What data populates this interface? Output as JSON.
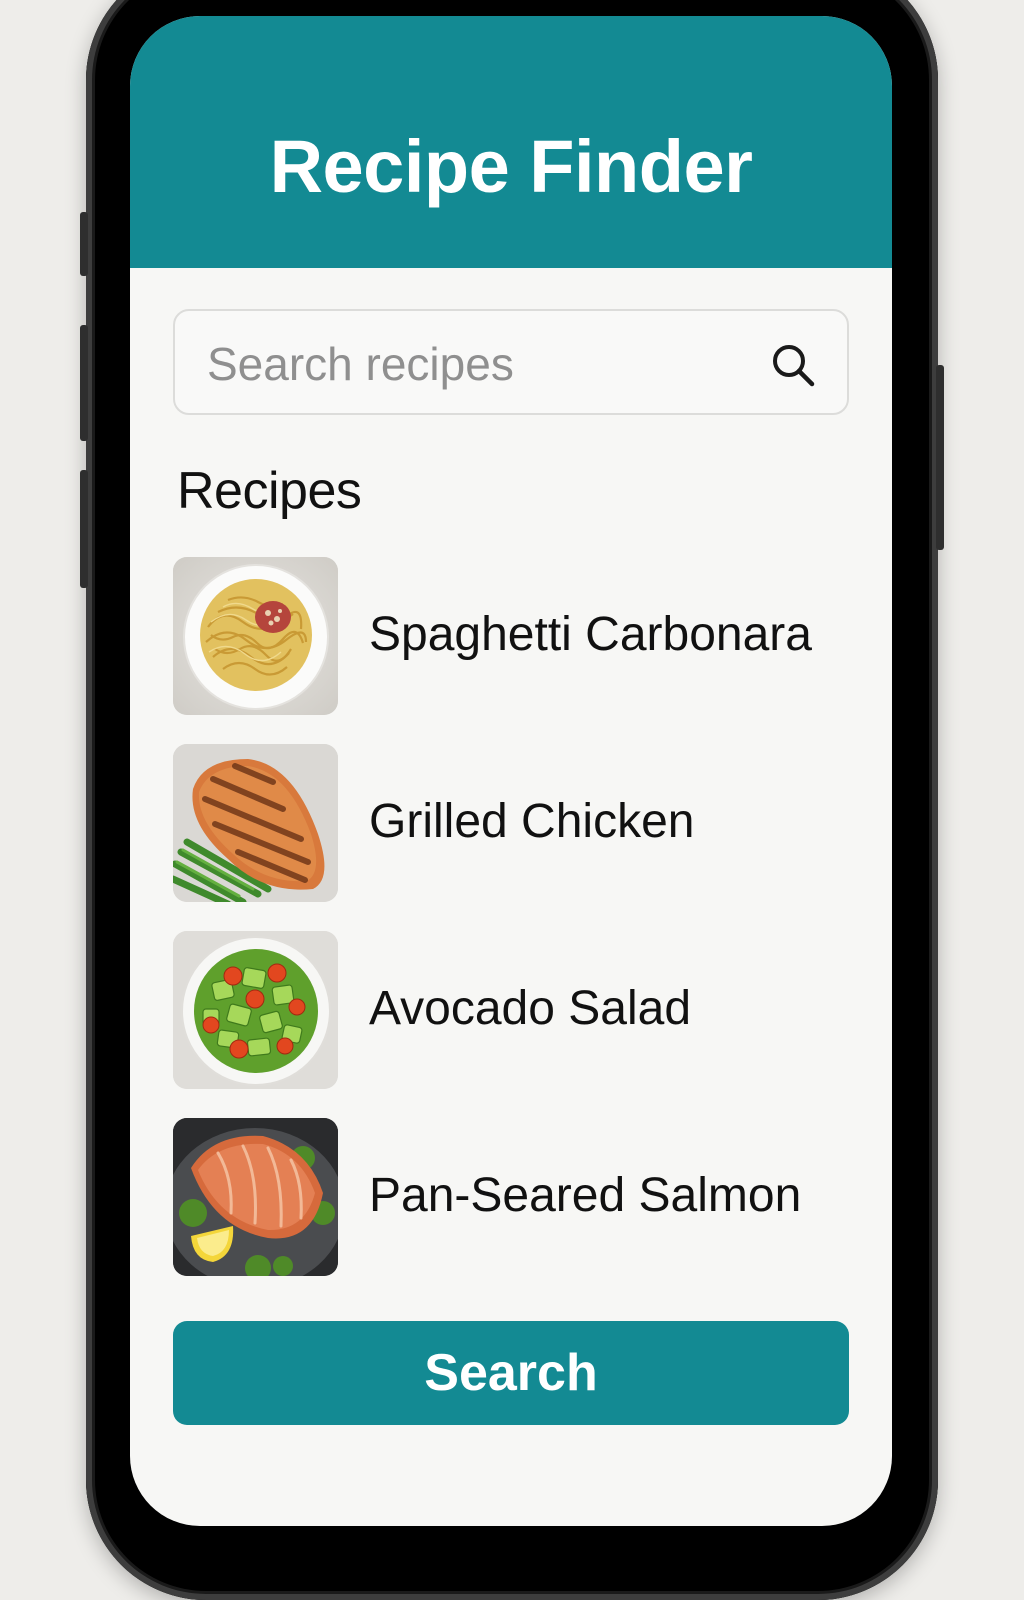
{
  "header": {
    "title": "Recipe Finder"
  },
  "search": {
    "placeholder": "Search recipes",
    "value": "",
    "icon": "search-icon"
  },
  "recipes_section": {
    "title": "Recipes",
    "items": [
      {
        "label": "Spaghetti Carbonara",
        "image": "spaghetti-carbonara-image"
      },
      {
        "label": "Grilled Chicken",
        "image": "grilled-chicken-image"
      },
      {
        "label": "Avocado Salad",
        "image": "avocado-salad-image"
      },
      {
        "label": "Pan-Seared Salmon",
        "image": "pan-seared-salmon-image"
      }
    ]
  },
  "actions": {
    "search_button_label": "Search"
  },
  "colors": {
    "accent": "#138a93",
    "background": "#f7f7f5",
    "text": "#111111"
  }
}
